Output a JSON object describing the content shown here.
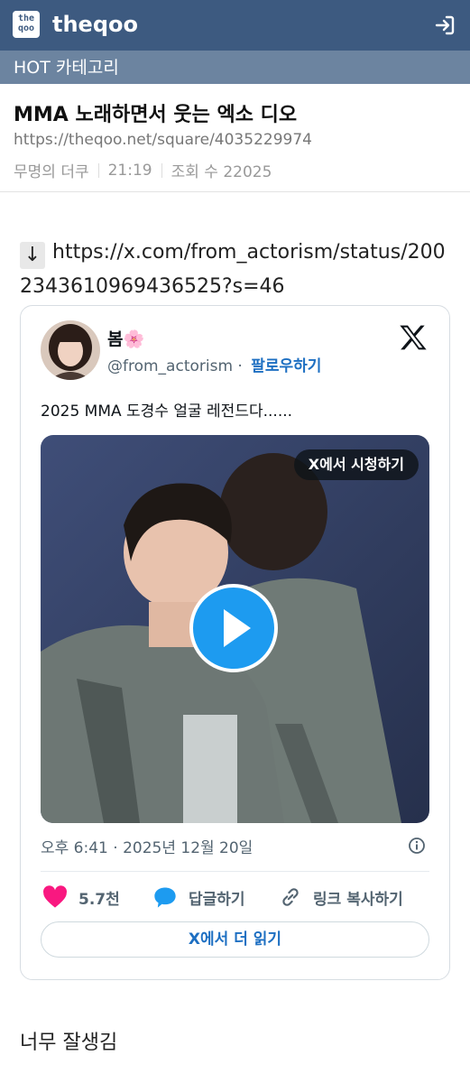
{
  "header": {
    "logo_text": "the qoo",
    "brand": "theqoo",
    "login_icon": "login-icon"
  },
  "category_bar": {
    "label": "HOT 카테고리"
  },
  "post": {
    "title": "MMA 노래하면서 웃는 엑소 디오",
    "url": "https://theqoo.net/square/4035229974",
    "author": "무명의 더쿠",
    "time": "21:19",
    "views": "조회 수 22025"
  },
  "body": {
    "arrow": "↓",
    "link_line1": "https://x.com/from_actorism/status/200",
    "link_line2": "2343610969436525?s=46",
    "closing_text": "너무 잘생김"
  },
  "tweet": {
    "name": "봄🌸",
    "handle": "@from_actorism",
    "handle_sep": " · ",
    "follow_label": "팔로우하기",
    "text": "2025 MMA 도경수 얼굴 레전드다......",
    "watch_label": "X에서 시청하기",
    "timestamp": "오후 6:41 · 2025년 12월 20일",
    "likes": "5.7천",
    "reply_label": "답글하기",
    "copy_link_label": "링크 복사하기",
    "read_more_label": "X에서 더 읽기",
    "colors": {
      "like": "#f91880",
      "reply": "#1d9bf0",
      "link": "#1d6fc2",
      "header": "#3d5a80"
    }
  }
}
